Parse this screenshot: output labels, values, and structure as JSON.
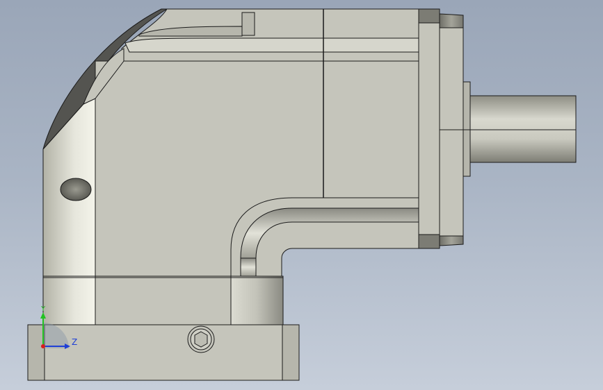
{
  "viewport": {
    "background_top": "#9aa6b8",
    "background_bottom": "#c6ceda"
  },
  "model": {
    "face_color": "#c5c5bb",
    "edge_color": "#1a1a1a",
    "icons": [
      "gearbox-housing",
      "output-shaft",
      "mounting-flange",
      "hex-socket-screw"
    ]
  },
  "triad": {
    "y_label": "Y",
    "z_label": "Z",
    "y_color": "#22c222",
    "z_color": "#1f3fd6",
    "x_color": "#d61f1f"
  }
}
